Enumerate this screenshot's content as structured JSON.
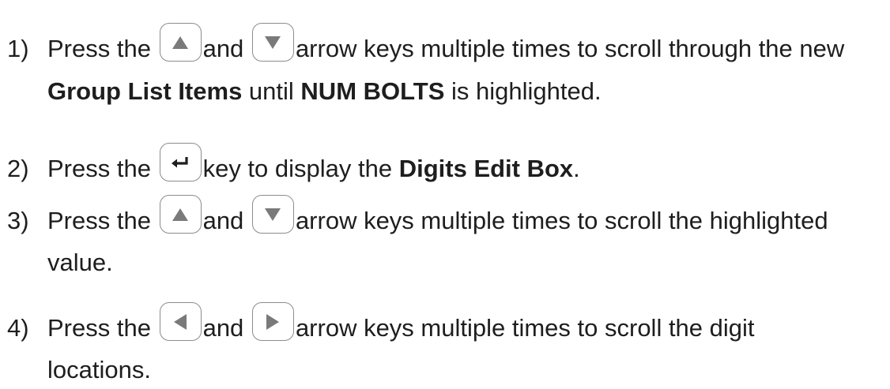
{
  "steps": [
    {
      "number": "1)",
      "press": "Press the",
      "and": "and",
      "rest": "arrow keys multiple times to scroll through the new",
      "cont_bold1": "Group List Items",
      "cont_mid": " until ",
      "cont_bold2": "NUM BOLTS",
      "cont_end": " is highlighted."
    },
    {
      "number": "2)",
      "press": "Press the",
      "rest_pre": "key to display the ",
      "rest_bold": "Digits Edit Box",
      "rest_end": "."
    },
    {
      "number": "3)",
      "press": "Press the",
      "and": "and",
      "rest": "arrow keys multiple times to scroll the highlighted",
      "cont": "value."
    },
    {
      "number": "4)",
      "press": "Press the",
      "and": "and",
      "rest": "arrow keys multiple times to scroll the digit",
      "cont": "locations."
    }
  ],
  "keys": {
    "up": "up-arrow-icon",
    "down": "down-arrow-icon",
    "enter": "enter-icon",
    "left": "left-arrow-icon",
    "right": "right-arrow-icon"
  },
  "colors": {
    "text": "#1e1e1e",
    "key_border": "#8c8c8c",
    "key_glyph": "#7a7a7a"
  }
}
